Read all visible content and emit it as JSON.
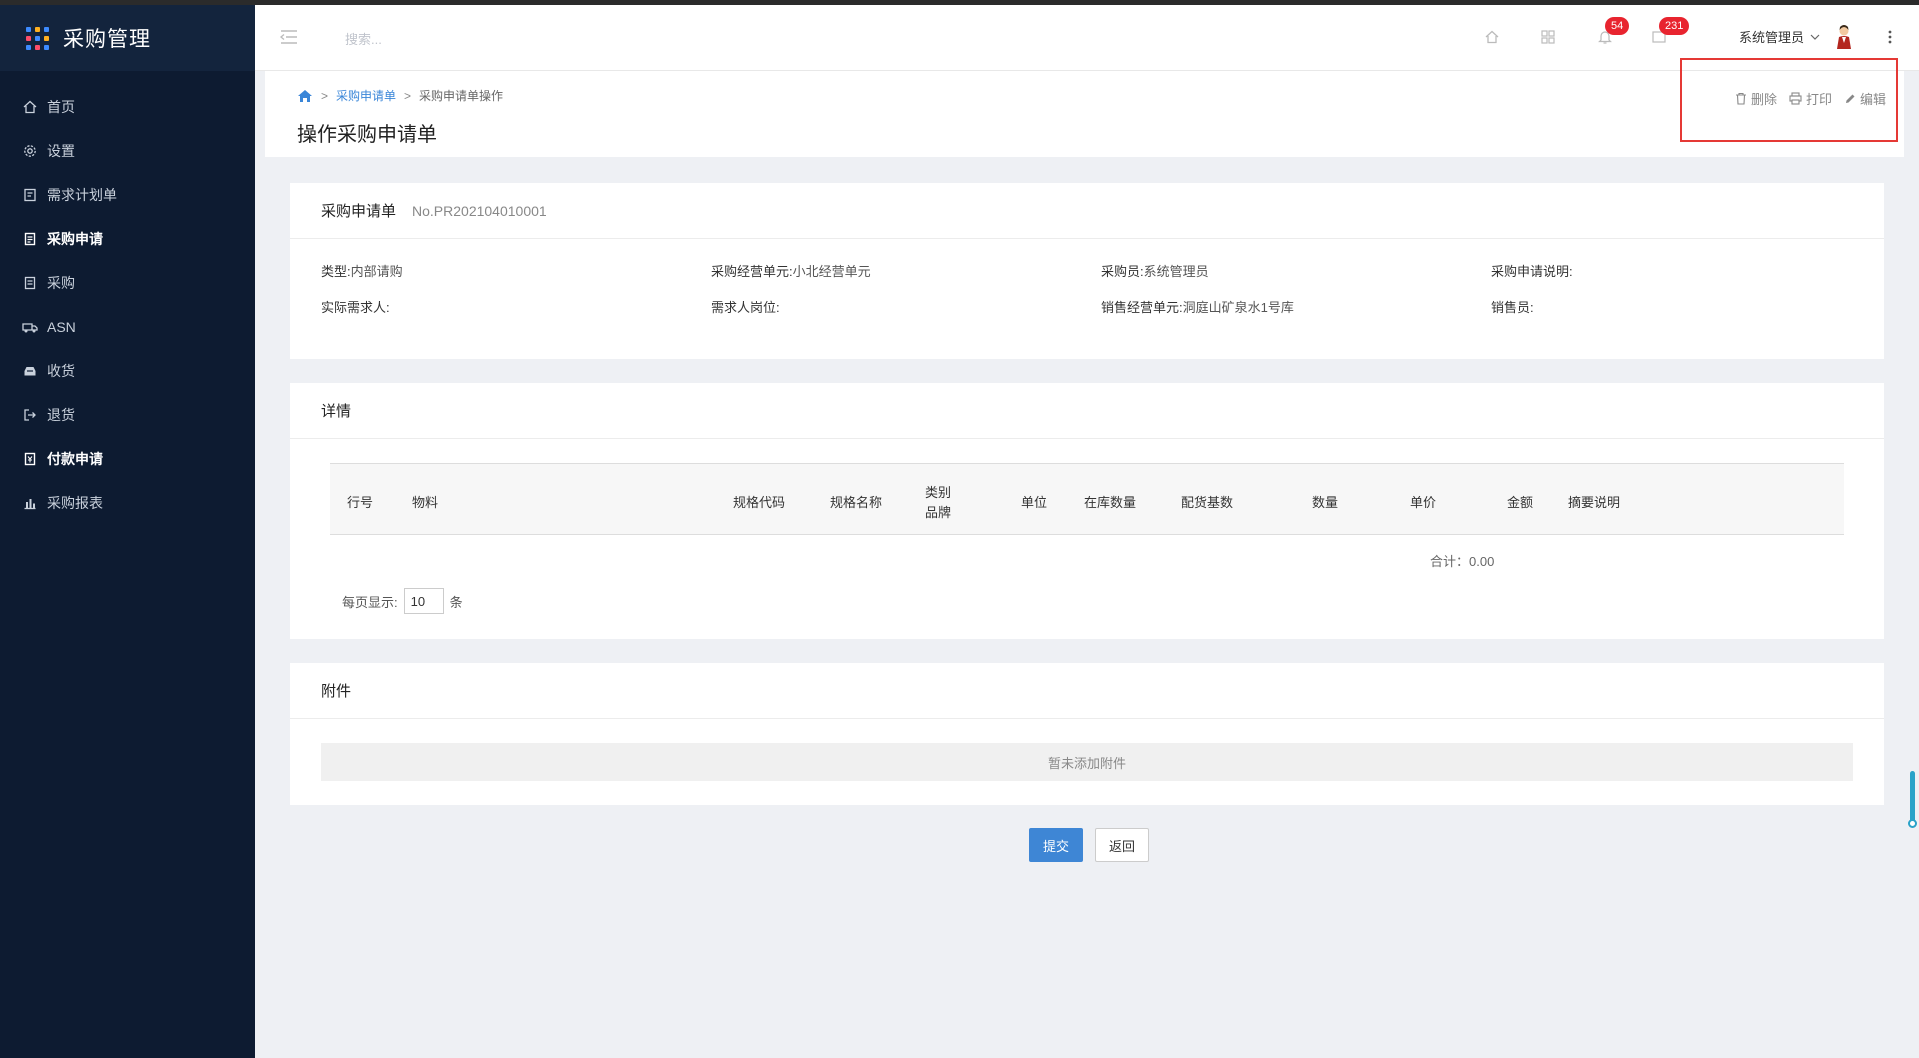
{
  "app": {
    "title": "采购管理"
  },
  "sidebar": {
    "items": [
      {
        "label": "首页",
        "icon": "home-icon"
      },
      {
        "label": "设置",
        "icon": "gear-icon"
      },
      {
        "label": "需求计划单",
        "icon": "document-icon"
      },
      {
        "label": "采购申请",
        "icon": "clipboard-icon"
      },
      {
        "label": "采购",
        "icon": "list-icon"
      },
      {
        "label": "ASN",
        "icon": "truck-icon"
      },
      {
        "label": "收货",
        "icon": "inbox-icon"
      },
      {
        "label": "退货",
        "icon": "return-icon"
      },
      {
        "label": "付款申请",
        "icon": "payment-icon"
      },
      {
        "label": "采购报表",
        "icon": "bar-chart-icon"
      }
    ]
  },
  "header": {
    "search_placeholder": "搜索...",
    "notifications_count": "54",
    "messages_count": "231",
    "user_name": "系统管理员"
  },
  "breadcrumb": {
    "level1": "采购申请单",
    "level2": "采购申请单操作"
  },
  "page": {
    "title": "操作采购申请单"
  },
  "actions": {
    "delete": "删除",
    "print": "打印",
    "edit": "编辑"
  },
  "order": {
    "title": "采购申请单",
    "number": "No.PR202104010001",
    "fields": {
      "type_label": "类型:",
      "type_value": "内部请购",
      "unit_label": "采购经营单元:",
      "unit_value": "小北经营单元",
      "buyer_label": "采购员:",
      "buyer_value": "系统管理员",
      "desc_label": "采购申请说明:",
      "desc_value": "",
      "requester_label": "实际需求人:",
      "requester_value": "",
      "position_label": "需求人岗位:",
      "position_value": "",
      "sales_unit_label": "销售经营单元:",
      "sales_unit_value": "洞庭山矿泉水1号库",
      "seller_label": "销售员:",
      "seller_value": ""
    }
  },
  "details": {
    "title": "详情",
    "columns": [
      "行号",
      "物料",
      "规格代码",
      "规格名称",
      "类别",
      "品牌",
      "单位",
      "在库数量",
      "配货基数",
      "数量",
      "单价",
      "金额",
      "摘要说明"
    ],
    "total": "合计：0.00",
    "per_page_label": "每页显示:",
    "per_page_value": "10",
    "per_page_unit": "条"
  },
  "attachments": {
    "title": "附件",
    "empty_text": "暂未添加附件"
  },
  "buttons": {
    "submit": "提交",
    "back": "返回"
  },
  "colors": {
    "sidebar": "#0d1b31",
    "primary": "#3e86d5",
    "badge": "#e8242f",
    "highlight_box": "#e53935"
  }
}
